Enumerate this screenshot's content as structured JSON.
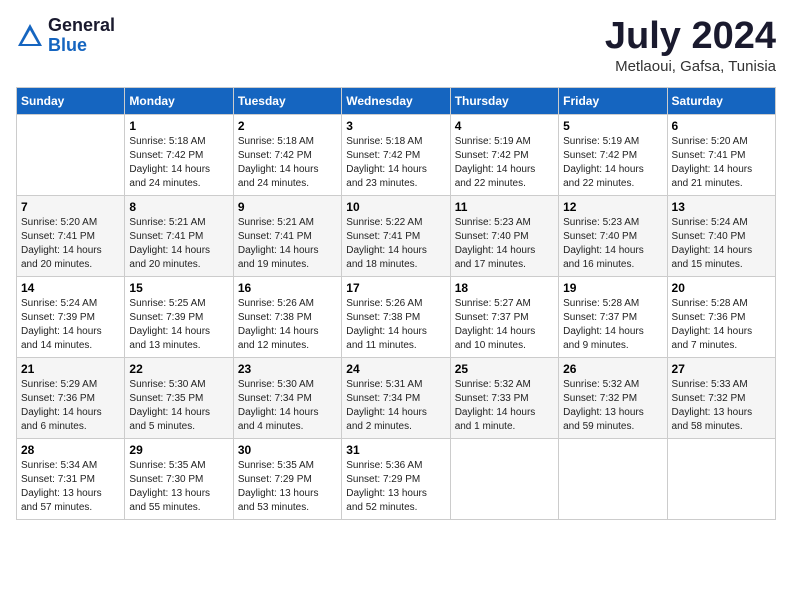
{
  "header": {
    "logo_general": "General",
    "logo_blue": "Blue",
    "month_title": "July 2024",
    "subtitle": "Metlaoui, Gafsa, Tunisia"
  },
  "days_of_week": [
    "Sunday",
    "Monday",
    "Tuesday",
    "Wednesday",
    "Thursday",
    "Friday",
    "Saturday"
  ],
  "weeks": [
    [
      {
        "day": "",
        "info": ""
      },
      {
        "day": "1",
        "info": "Sunrise: 5:18 AM\nSunset: 7:42 PM\nDaylight: 14 hours\nand 24 minutes."
      },
      {
        "day": "2",
        "info": "Sunrise: 5:18 AM\nSunset: 7:42 PM\nDaylight: 14 hours\nand 24 minutes."
      },
      {
        "day": "3",
        "info": "Sunrise: 5:18 AM\nSunset: 7:42 PM\nDaylight: 14 hours\nand 23 minutes."
      },
      {
        "day": "4",
        "info": "Sunrise: 5:19 AM\nSunset: 7:42 PM\nDaylight: 14 hours\nand 22 minutes."
      },
      {
        "day": "5",
        "info": "Sunrise: 5:19 AM\nSunset: 7:42 PM\nDaylight: 14 hours\nand 22 minutes."
      },
      {
        "day": "6",
        "info": "Sunrise: 5:20 AM\nSunset: 7:41 PM\nDaylight: 14 hours\nand 21 minutes."
      }
    ],
    [
      {
        "day": "7",
        "info": "Sunrise: 5:20 AM\nSunset: 7:41 PM\nDaylight: 14 hours\nand 20 minutes."
      },
      {
        "day": "8",
        "info": "Sunrise: 5:21 AM\nSunset: 7:41 PM\nDaylight: 14 hours\nand 20 minutes."
      },
      {
        "day": "9",
        "info": "Sunrise: 5:21 AM\nSunset: 7:41 PM\nDaylight: 14 hours\nand 19 minutes."
      },
      {
        "day": "10",
        "info": "Sunrise: 5:22 AM\nSunset: 7:41 PM\nDaylight: 14 hours\nand 18 minutes."
      },
      {
        "day": "11",
        "info": "Sunrise: 5:23 AM\nSunset: 7:40 PM\nDaylight: 14 hours\nand 17 minutes."
      },
      {
        "day": "12",
        "info": "Sunrise: 5:23 AM\nSunset: 7:40 PM\nDaylight: 14 hours\nand 16 minutes."
      },
      {
        "day": "13",
        "info": "Sunrise: 5:24 AM\nSunset: 7:40 PM\nDaylight: 14 hours\nand 15 minutes."
      }
    ],
    [
      {
        "day": "14",
        "info": "Sunrise: 5:24 AM\nSunset: 7:39 PM\nDaylight: 14 hours\nand 14 minutes."
      },
      {
        "day": "15",
        "info": "Sunrise: 5:25 AM\nSunset: 7:39 PM\nDaylight: 14 hours\nand 13 minutes."
      },
      {
        "day": "16",
        "info": "Sunrise: 5:26 AM\nSunset: 7:38 PM\nDaylight: 14 hours\nand 12 minutes."
      },
      {
        "day": "17",
        "info": "Sunrise: 5:26 AM\nSunset: 7:38 PM\nDaylight: 14 hours\nand 11 minutes."
      },
      {
        "day": "18",
        "info": "Sunrise: 5:27 AM\nSunset: 7:37 PM\nDaylight: 14 hours\nand 10 minutes."
      },
      {
        "day": "19",
        "info": "Sunrise: 5:28 AM\nSunset: 7:37 PM\nDaylight: 14 hours\nand 9 minutes."
      },
      {
        "day": "20",
        "info": "Sunrise: 5:28 AM\nSunset: 7:36 PM\nDaylight: 14 hours\nand 7 minutes."
      }
    ],
    [
      {
        "day": "21",
        "info": "Sunrise: 5:29 AM\nSunset: 7:36 PM\nDaylight: 14 hours\nand 6 minutes."
      },
      {
        "day": "22",
        "info": "Sunrise: 5:30 AM\nSunset: 7:35 PM\nDaylight: 14 hours\nand 5 minutes."
      },
      {
        "day": "23",
        "info": "Sunrise: 5:30 AM\nSunset: 7:34 PM\nDaylight: 14 hours\nand 4 minutes."
      },
      {
        "day": "24",
        "info": "Sunrise: 5:31 AM\nSunset: 7:34 PM\nDaylight: 14 hours\nand 2 minutes."
      },
      {
        "day": "25",
        "info": "Sunrise: 5:32 AM\nSunset: 7:33 PM\nDaylight: 14 hours\nand 1 minute."
      },
      {
        "day": "26",
        "info": "Sunrise: 5:32 AM\nSunset: 7:32 PM\nDaylight: 13 hours\nand 59 minutes."
      },
      {
        "day": "27",
        "info": "Sunrise: 5:33 AM\nSunset: 7:32 PM\nDaylight: 13 hours\nand 58 minutes."
      }
    ],
    [
      {
        "day": "28",
        "info": "Sunrise: 5:34 AM\nSunset: 7:31 PM\nDaylight: 13 hours\nand 57 minutes."
      },
      {
        "day": "29",
        "info": "Sunrise: 5:35 AM\nSunset: 7:30 PM\nDaylight: 13 hours\nand 55 minutes."
      },
      {
        "day": "30",
        "info": "Sunrise: 5:35 AM\nSunset: 7:29 PM\nDaylight: 13 hours\nand 53 minutes."
      },
      {
        "day": "31",
        "info": "Sunrise: 5:36 AM\nSunset: 7:29 PM\nDaylight: 13 hours\nand 52 minutes."
      },
      {
        "day": "",
        "info": ""
      },
      {
        "day": "",
        "info": ""
      },
      {
        "day": "",
        "info": ""
      }
    ]
  ]
}
